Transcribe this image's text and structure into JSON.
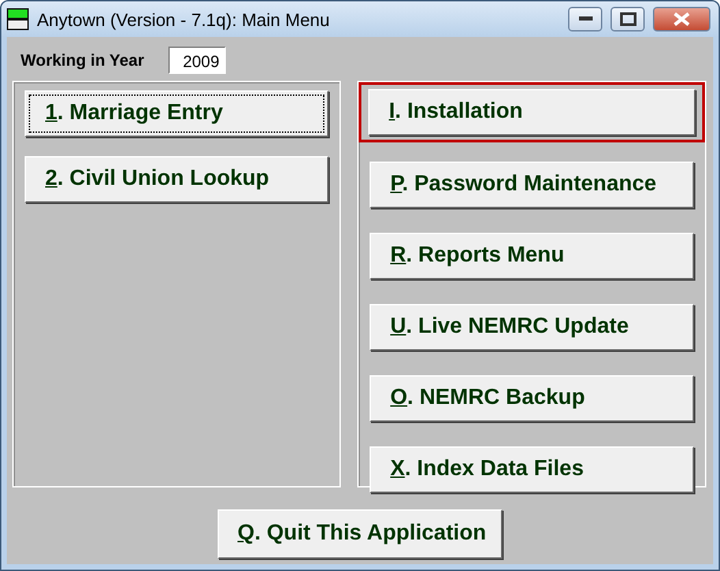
{
  "window": {
    "title": "Anytown (Version - 7.1q):  Main Menu"
  },
  "working_year": {
    "label": "Working in Year",
    "value": "2009"
  },
  "left_menu": [
    {
      "key": "1",
      "label": ".  Marriage Entry",
      "focused": true,
      "highlighted": false
    },
    {
      "key": "2",
      "label": ". Civil Union Lookup",
      "focused": false,
      "highlighted": false
    }
  ],
  "right_menu": [
    {
      "key": "I",
      "label": ".  Installation",
      "focused": false,
      "highlighted": true
    },
    {
      "key": "P",
      "label": ".  Password Maintenance",
      "focused": false,
      "highlighted": false
    },
    {
      "key": "R",
      "label": ".  Reports Menu",
      "focused": false,
      "highlighted": false
    },
    {
      "key": "U",
      "label": ". Live NEMRC Update",
      "focused": false,
      "highlighted": false
    },
    {
      "key": "O",
      "label": ". NEMRC Backup",
      "focused": false,
      "highlighted": false
    },
    {
      "key": "X",
      "label": ".  Index Data Files",
      "focused": false,
      "highlighted": false
    }
  ],
  "quit_button": {
    "key": "Q",
    "label": ".  Quit This Application"
  }
}
